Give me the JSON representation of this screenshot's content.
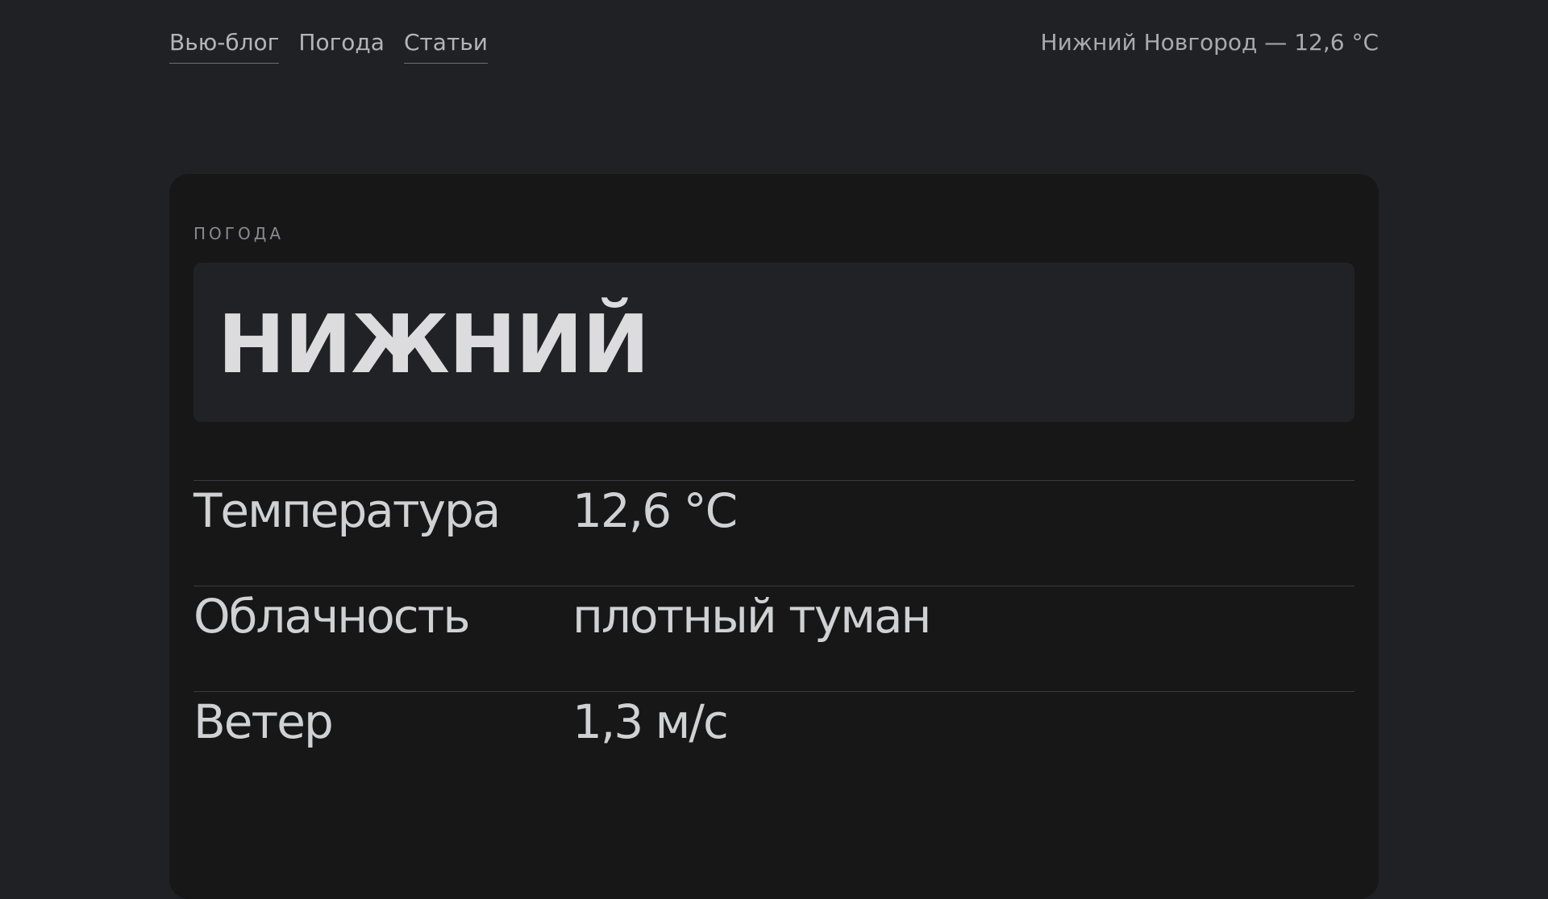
{
  "nav": {
    "items": [
      {
        "label": "Вью-блог"
      },
      {
        "label": "Погода"
      },
      {
        "label": "Статьи"
      }
    ]
  },
  "header": {
    "current_weather": "Нижний Новгород — 12,6 °C"
  },
  "card": {
    "eyebrow": "ПОГОДА",
    "city": "НИЖНИЙ",
    "rows": [
      {
        "label": "Температура",
        "value": "12,6 °C"
      },
      {
        "label": "Облачность",
        "value": "плотный туман"
      },
      {
        "label": "Ветер",
        "value": "1,3 м/с"
      }
    ]
  }
}
